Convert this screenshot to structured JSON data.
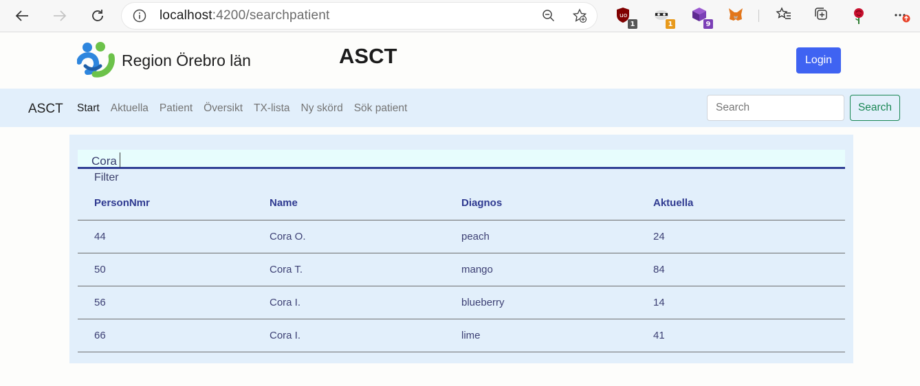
{
  "browser": {
    "url_host": "localhost",
    "url_path": ":4200/searchpatient",
    "extensions": [
      {
        "name": "ublock-icon",
        "badge": "1",
        "badge_color": "#555555"
      },
      {
        "name": "raccoon-icon",
        "badge": "1",
        "badge_color": "#e89a1c"
      },
      {
        "name": "cube-icon",
        "badge": "9",
        "badge_color": "#7b3fb6"
      },
      {
        "name": "metamask-fox-icon",
        "badge": "",
        "badge_color": ""
      }
    ]
  },
  "header": {
    "logo_text": "Region Örebro län",
    "app_title": "ASCT",
    "login_label": "Login"
  },
  "navbar": {
    "brand": "ASCT",
    "links": [
      "Start",
      "Aktuella",
      "Patient",
      "Översikt",
      "TX-lista",
      "Ny skörd",
      "Sök patient"
    ],
    "search_placeholder": "Search",
    "search_button": "Search"
  },
  "filter": {
    "value": "Cora",
    "label": "Filter"
  },
  "table": {
    "headers": [
      "PersonNmr",
      "Name",
      "Diagnos",
      "Aktuella"
    ],
    "rows": [
      [
        "44",
        "Cora O.",
        "peach",
        "24"
      ],
      [
        "50",
        "Cora T.",
        "mango",
        "84"
      ],
      [
        "56",
        "Cora I.",
        "blueberry",
        "14"
      ],
      [
        "66",
        "Cora I.",
        "lime",
        "41"
      ]
    ]
  },
  "colors": {
    "accent": "#3f63f2",
    "navbar_bg": "#e2effb",
    "header_text": "#2e3990",
    "success": "#198754"
  }
}
